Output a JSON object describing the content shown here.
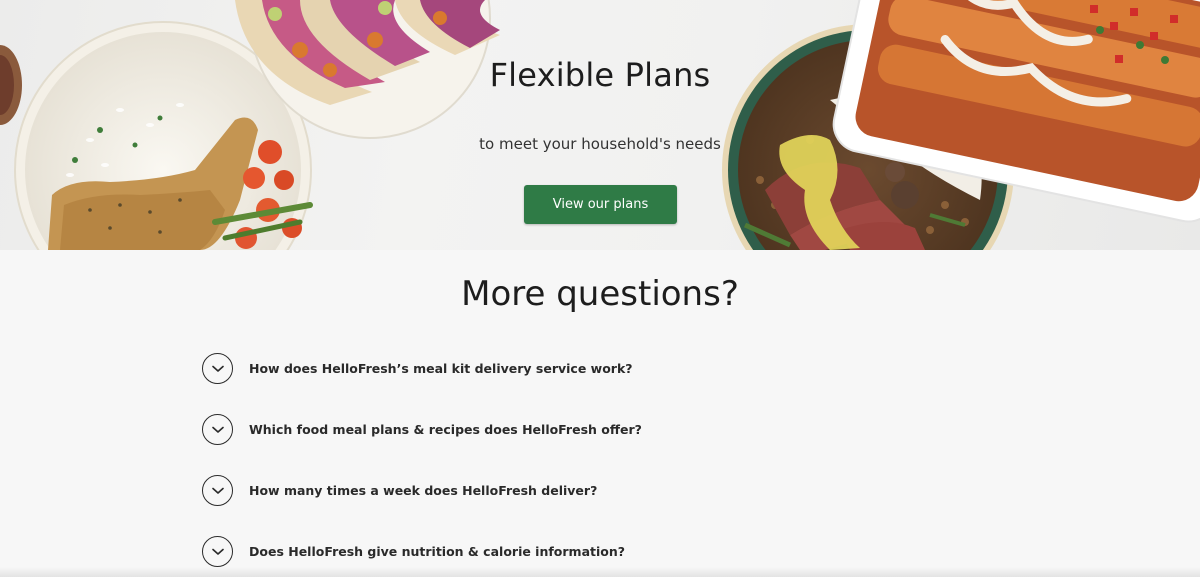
{
  "hero": {
    "title": "Flexible Plans",
    "subtitle": "to meet your household's needs",
    "cta_label": "View our plans",
    "cta_color": "#2f7b46"
  },
  "faq": {
    "title": "More questions?",
    "toggle_icon": "chevron-down-icon",
    "items": [
      {
        "question": "How does HelloFresh’s meal kit delivery service work?"
      },
      {
        "question": "Which food meal plans & recipes does HelloFresh offer?"
      },
      {
        "question": "How many times a week does HelloFresh deliver?"
      },
      {
        "question": "Does HelloFresh give nutrition & calorie information?"
      }
    ]
  },
  "colors": {
    "page_background": "#f7f7f7",
    "text": "#1d1d1d",
    "accent": "#2f7b46"
  }
}
